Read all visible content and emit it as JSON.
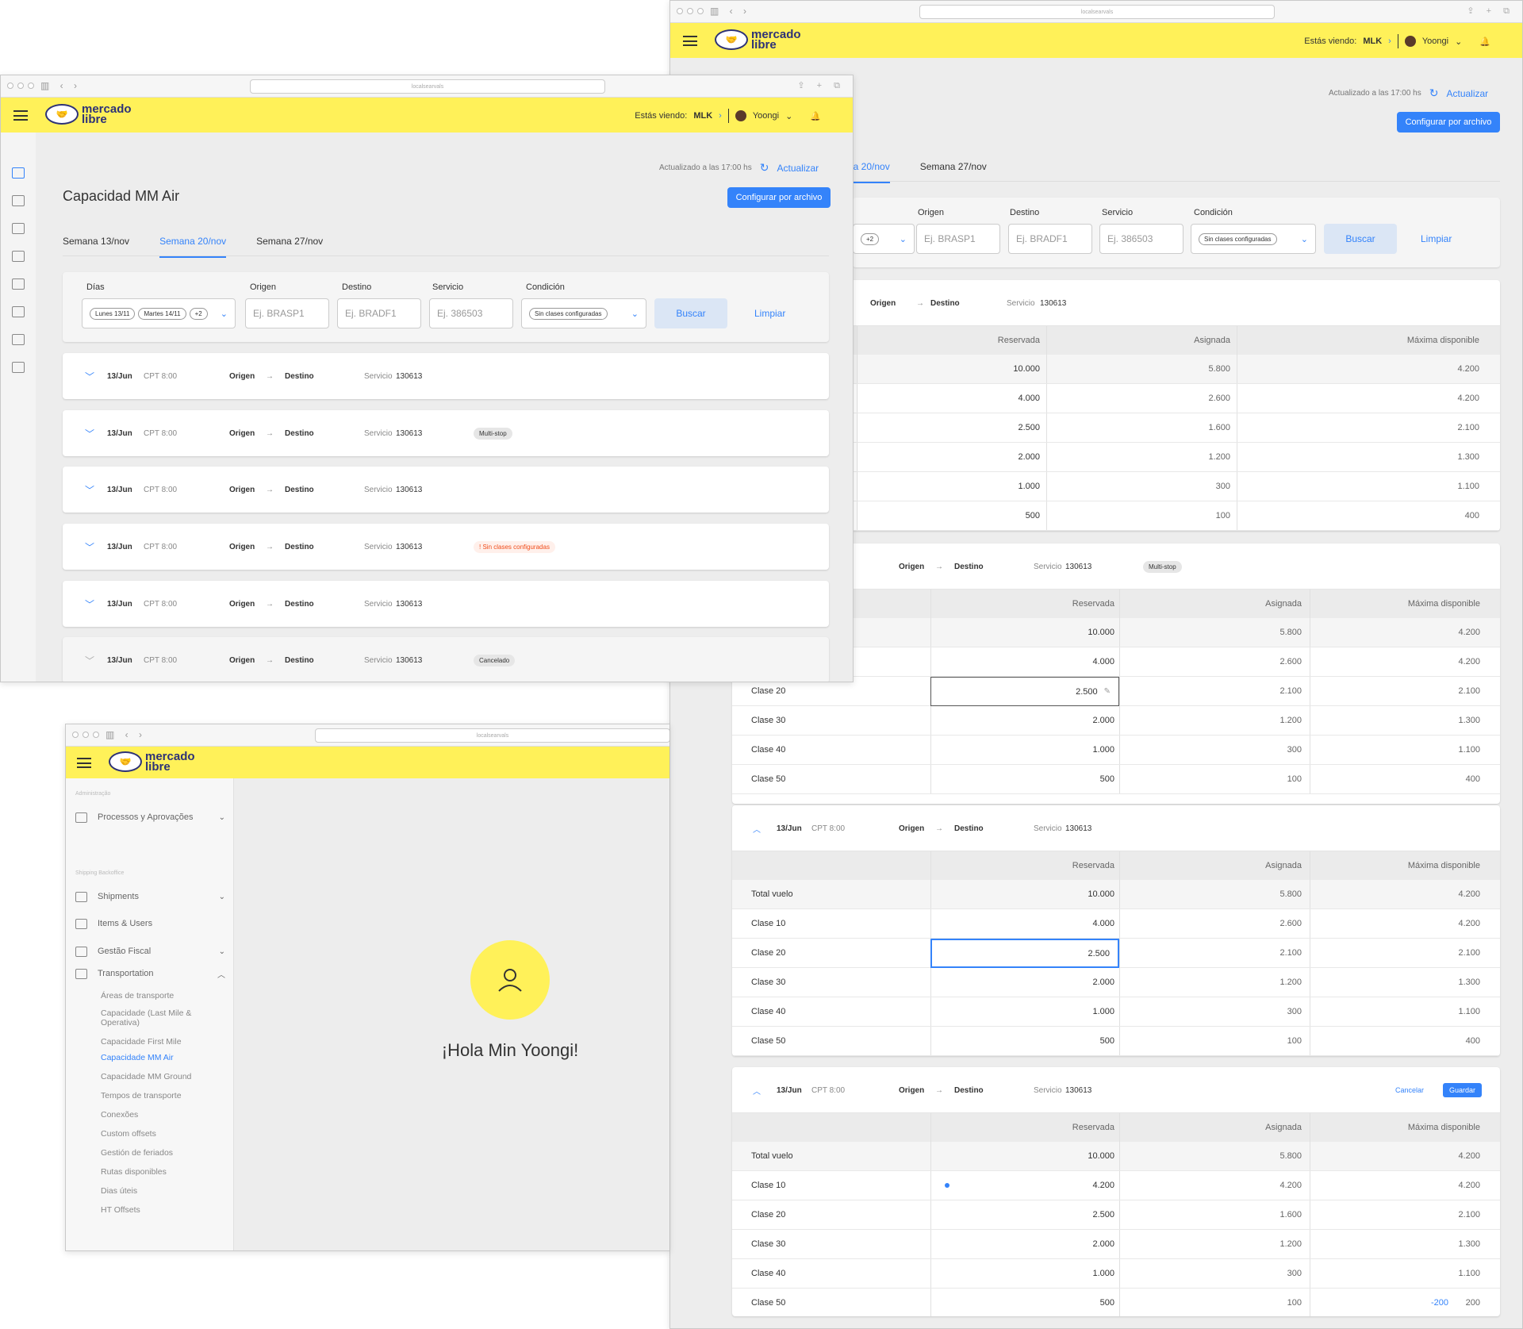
{
  "browser": {
    "url": "localsearvals"
  },
  "header": {
    "viewing_label": "Estás viendo:",
    "viewing_site": "MLK",
    "user": "Yoongi",
    "logo_line1": "mercado",
    "logo_line2": "libre"
  },
  "page": {
    "title": "Capacidad MM Air",
    "updated": "Actualizado a las 17:00 hs",
    "refresh": "Actualizar",
    "config_button": "Configurar por archivo",
    "tabs": [
      "Semana 13/nov",
      "Semana 20/nov",
      "Semana 27/nov"
    ],
    "tabs_partial": "na 20/nov",
    "filters": {
      "days_label": "Días",
      "origin_label": "Origen",
      "dest_label": "Destino",
      "service_label": "Servicio",
      "condition_label": "Condición",
      "day_chips": [
        "Lunes 13/11",
        "Martes 14/11",
        "+2"
      ],
      "origin_ph": "Ej. BRASP1",
      "dest_ph": "Ej. BRADF1",
      "service_ph": "Ej. 386503",
      "condition_value": "Sin clases configuradas",
      "search": "Buscar",
      "clear": "Limpiar"
    },
    "rows": [
      {
        "date": "13/Jun",
        "cpt": "CPT 8:00",
        "origin": "Origen",
        "dest": "Destino",
        "svc_label": "Servicio",
        "svc": "130613",
        "tag": ""
      },
      {
        "date": "13/Jun",
        "cpt": "CPT 8:00",
        "origin": "Origen",
        "dest": "Destino",
        "svc_label": "Servicio",
        "svc": "130613",
        "tag": "Multi-stop"
      },
      {
        "date": "13/Jun",
        "cpt": "CPT 8:00",
        "origin": "Origen",
        "dest": "Destino",
        "svc_label": "Servicio",
        "svc": "130613",
        "tag": ""
      },
      {
        "date": "13/Jun",
        "cpt": "CPT 8:00",
        "origin": "Origen",
        "dest": "Destino",
        "svc_label": "Servicio",
        "svc": "130613",
        "tag": "Sin clases configuradas"
      },
      {
        "date": "13/Jun",
        "cpt": "CPT 8:00",
        "origin": "Origen",
        "dest": "Destino",
        "svc_label": "Servicio",
        "svc": "130613",
        "tag": ""
      },
      {
        "date": "13/Jun",
        "cpt": "CPT 8:00",
        "origin": "Origen",
        "dest": "Destino",
        "svc_label": "Servicio",
        "svc": "130613",
        "tag": "Cancelado"
      }
    ]
  },
  "table": {
    "headers": [
      "Reservada",
      "Asignada",
      "Máxima disponible"
    ],
    "card1_rows": [
      [
        "10.000",
        "5.800",
        "4.200"
      ],
      [
        "4.000",
        "2.600",
        "4.200"
      ],
      [
        "2.500",
        "1.600",
        "2.100"
      ],
      [
        "2.000",
        "1.200",
        "1.300"
      ],
      [
        "1.000",
        "300",
        "1.100"
      ],
      [
        "500",
        "100",
        "400"
      ]
    ],
    "card2_head": {
      "origin": "Origen",
      "dest": "Destino",
      "svc_label": "Servicio",
      "svc": "130613",
      "tag": "Multi-stop"
    },
    "card2_rows": [
      [
        "",
        "10.000",
        "5.800",
        "4.200"
      ],
      [
        "",
        "4.000",
        "2.600",
        "4.200"
      ],
      [
        "Clase 20",
        "2.500",
        "2.100",
        "2.100"
      ],
      [
        "Clase 30",
        "2.000",
        "1.200",
        "1.300"
      ],
      [
        "Clase 40",
        "1.000",
        "300",
        "1.100"
      ],
      [
        "Clase 50",
        "500",
        "100",
        "400"
      ]
    ],
    "card3_head": {
      "date": "13/Jun",
      "cpt": "CPT 8:00",
      "origin": "Origen",
      "dest": "Destino",
      "svc_label": "Servicio",
      "svc": "130613"
    },
    "card3_rows": [
      [
        "Total vuelo",
        "10.000",
        "5.800",
        "4.200"
      ],
      [
        "Clase 10",
        "4.000",
        "2.600",
        "4.200"
      ],
      [
        "Clase 20",
        "2.500",
        "2.100",
        "2.100"
      ],
      [
        "Clase 30",
        "2.000",
        "1.200",
        "1.300"
      ],
      [
        "Clase 40",
        "1.000",
        "300",
        "1.100"
      ],
      [
        "Clase 50",
        "500",
        "100",
        "400"
      ]
    ],
    "card4_head": {
      "date": "13/Jun",
      "cpt": "CPT 8:00",
      "origin": "Origen",
      "dest": "Destino",
      "svc_label": "Servicio",
      "svc": "130613",
      "cancel": "Cancelar",
      "save": "Guardar"
    },
    "card4_rows": [
      [
        "Total vuelo",
        "10.000",
        "5.800",
        "4.200"
      ],
      [
        "Clase 10",
        "4.200",
        "4.200",
        "4.200"
      ],
      [
        "Clase 20",
        "2.500",
        "1.600",
        "2.100"
      ],
      [
        "Clase 30",
        "2.000",
        "1.200",
        "1.300"
      ],
      [
        "Clase 40",
        "1.000",
        "300",
        "1.100"
      ],
      [
        "Clase 50",
        "500",
        "100",
        "200"
      ]
    ],
    "card4_delta": "-200"
  },
  "sidebar": {
    "section1": "Administração",
    "item_process": "Processos y Aprovações",
    "section2": "Shipping Backoffice",
    "items": [
      "Shipments",
      "Items & Users",
      "Gestão Fiscal",
      "Transportation"
    ],
    "sub": [
      "Áreas de transporte",
      "Capacidade (Last Mile & Operativa)",
      "Capacidade First Mile",
      "Capacidade MM Air",
      "Capacidade MM Ground",
      "Tempos de transporte",
      "Conexões",
      "Custom offsets",
      "Gestión de feriados",
      "Rutas disponibles",
      "Dias úteis",
      "HT Offsets"
    ],
    "greeting": "¡Hola Min Yoongi!"
  },
  "colors": {
    "brand_yellow": "#fff159",
    "accent": "#3483fa",
    "warn": "#f04c1a"
  }
}
